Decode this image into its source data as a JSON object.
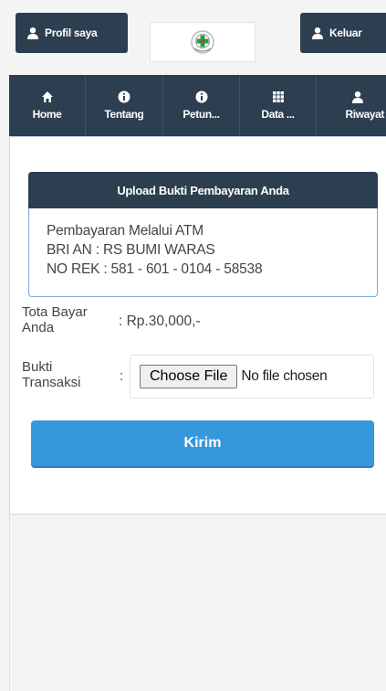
{
  "topbar": {
    "profil_label": "Profil saya",
    "keluar_label": "Keluar",
    "profil_icon": "user-icon",
    "keluar_icon": "user-icon",
    "logo_icon": "hospital-logo-icon"
  },
  "nav": {
    "items": [
      {
        "label": "Home",
        "icon": "home-icon"
      },
      {
        "label": "Tentang",
        "icon": "info-icon"
      },
      {
        "label": "Petun...",
        "icon": "info-icon"
      },
      {
        "label": "Data ...",
        "icon": "grid-icon"
      },
      {
        "label": "Riwayat",
        "icon": "user-icon"
      }
    ]
  },
  "upload": {
    "title": "Upload Bukti Pembayaran Anda",
    "info_lines": [
      "Pembayaran Melalui ATM",
      "BRI AN : RS BUMI WARAS",
      "NO REK : 581 - 601 - 0104 - 58538"
    ],
    "total_label_line1": "Tota Bayar",
    "total_label_line2": "Anda",
    "total_value": ": Rp.30,000,-",
    "bukti_label_line1": "Bukti",
    "bukti_label_line2": "Transaksi",
    "bukti_colon": ":",
    "choose_file_label": "Choose File",
    "file_status": "No file chosen",
    "submit_label": "Kirim"
  },
  "colors": {
    "navy": "#2c3e50",
    "accent_blue": "#3498db",
    "card_border": "#76aadb"
  }
}
